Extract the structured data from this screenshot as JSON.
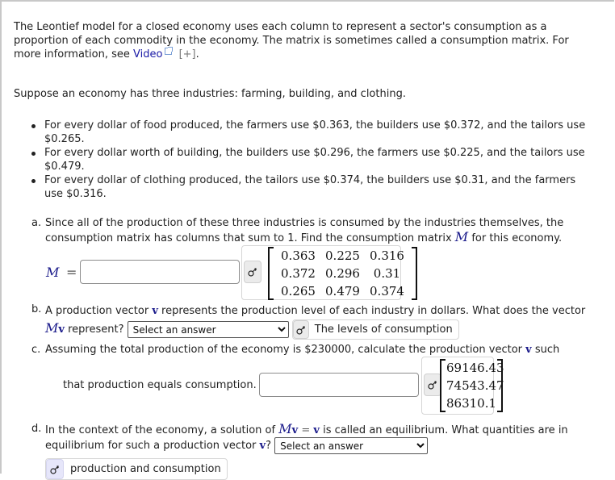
{
  "intro": {
    "text": "The Leontief model for a closed economy uses each column to represent a sector's consumption as a proportion of each commodity in the economy. The matrix is sometimes called a consumption matrix. For more information, see",
    "link_label": "Video",
    "expand_label": "[+]",
    "trailing": "."
  },
  "setup": "Suppose an economy has three industries: farming, building, and clothing.",
  "bullets": [
    "For every dollar of food produced, the farmers use $0.363, the builders use $0.372, and the tailors use $0.265.",
    "For every dollar worth of building, the builders use $0.296, the farmers use $0.225, and the tailors use $0.479.",
    "For every dollar of clothing produced, the tailors use $0.374, the builders use $0.31, and the farmers use $0.316."
  ],
  "part_a": {
    "label": "a.",
    "text1": "Since all of the production of these three industries is consumed by the industries themselves, the consumption matrix has columns that sum to 1. Find the consumption matrix",
    "var": "M",
    "text2": "for this economy.",
    "input_label": "M",
    "equals": "=",
    "input_value": "",
    "answer_matrix": [
      [
        "0.363",
        "0.225",
        "0.316"
      ],
      [
        "0.372",
        "0.296",
        "0.31"
      ],
      [
        "0.265",
        "0.479",
        "0.374"
      ]
    ]
  },
  "part_b": {
    "label": "b.",
    "text1": "A production vector",
    "vec": "v",
    "text2": "represents the production level of each industry in dollars. What does the vector",
    "expr_M": "M",
    "expr_v": "v",
    "text3": "represent?",
    "select_value": "Select an answer",
    "answer": "The levels of consumption"
  },
  "part_c": {
    "label": "c.",
    "text1": "Assuming the total production of the economy is $230000, calculate the production vector",
    "vec": "v",
    "text2": "such",
    "text3": "that production equals consumption.",
    "input_value": "",
    "answer_vector": [
      "69146.43",
      "74543.47",
      "86310.1"
    ]
  },
  "part_d": {
    "label": "d.",
    "text1": "In the context of the economy, a solution of",
    "expr_M": "M",
    "expr_v": "v",
    "eq": "=",
    "expr_v2": "v",
    "text2": "is called an equilibrium. What quantities are in equilibrium for such a production vector",
    "vec": "v",
    "q": "?",
    "select_value": "Select an answer",
    "answer": "production and consumption"
  },
  "icons": {
    "key": "key-icon",
    "external": "external-link-icon"
  },
  "colors": {
    "link": "#1a1aa6",
    "math": "#1a1a8a",
    "key_button": "#ebebeb",
    "key_button_highlight": "#e6e6fa",
    "frame": "#c8c8c8"
  }
}
